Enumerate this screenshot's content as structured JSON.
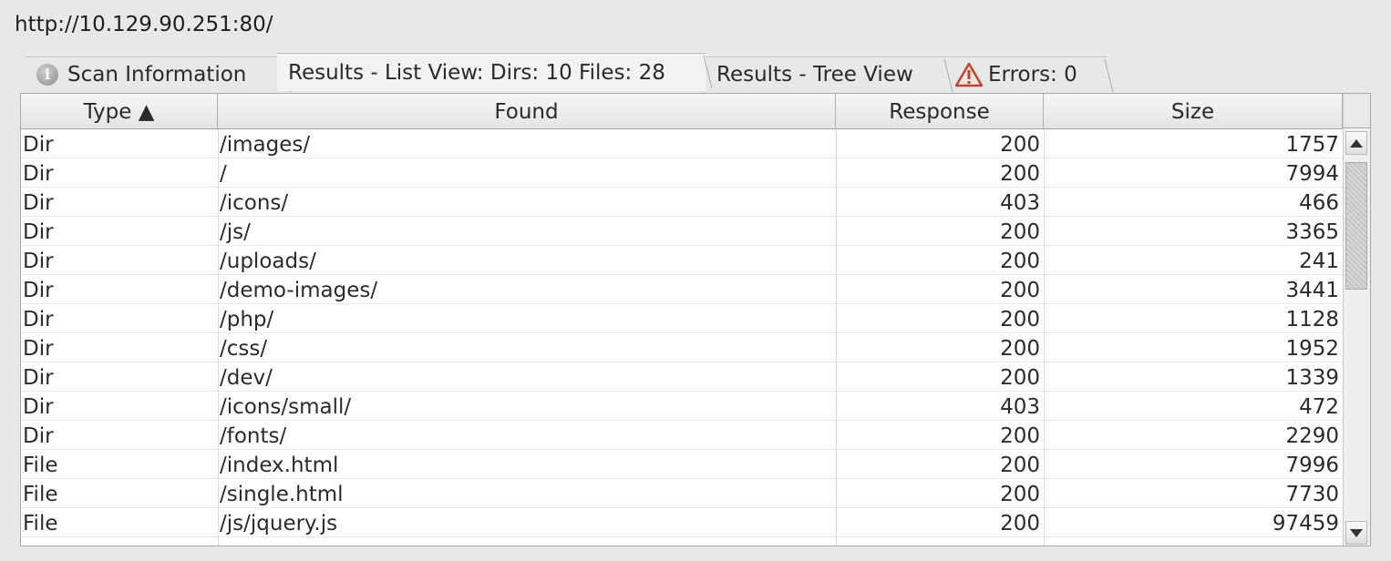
{
  "url": "http://10.129.90.251:80/",
  "tabs": [
    {
      "label": "Scan Information"
    },
    {
      "label": "Results - List View: Dirs: 10 Files: 28"
    },
    {
      "label": "Results - Tree View"
    },
    {
      "label": "Errors: 0"
    }
  ],
  "table": {
    "headers": {
      "type": "Type ▲",
      "found": "Found",
      "response": "Response",
      "size": "Size"
    },
    "rows": [
      {
        "type": "Dir",
        "found": "/images/",
        "response": "200",
        "size": "1757"
      },
      {
        "type": "Dir",
        "found": "/",
        "response": "200",
        "size": "7994"
      },
      {
        "type": "Dir",
        "found": "/icons/",
        "response": "403",
        "size": "466"
      },
      {
        "type": "Dir",
        "found": "/js/",
        "response": "200",
        "size": "3365"
      },
      {
        "type": "Dir",
        "found": "/uploads/",
        "response": "200",
        "size": "241"
      },
      {
        "type": "Dir",
        "found": "/demo-images/",
        "response": "200",
        "size": "3441"
      },
      {
        "type": "Dir",
        "found": "/php/",
        "response": "200",
        "size": "1128"
      },
      {
        "type": "Dir",
        "found": "/css/",
        "response": "200",
        "size": "1952"
      },
      {
        "type": "Dir",
        "found": "/dev/",
        "response": "200",
        "size": "1339"
      },
      {
        "type": "Dir",
        "found": "/icons/small/",
        "response": "403",
        "size": "472"
      },
      {
        "type": "Dir",
        "found": "/fonts/",
        "response": "200",
        "size": "2290"
      },
      {
        "type": "File",
        "found": "/index.html",
        "response": "200",
        "size": "7996"
      },
      {
        "type": "File",
        "found": "/single.html",
        "response": "200",
        "size": "7730"
      },
      {
        "type": "File",
        "found": "/js/jquery.js",
        "response": "200",
        "size": "97459"
      }
    ]
  },
  "colors": {
    "warning": "#b5482e",
    "background": "#e8e8e8"
  }
}
